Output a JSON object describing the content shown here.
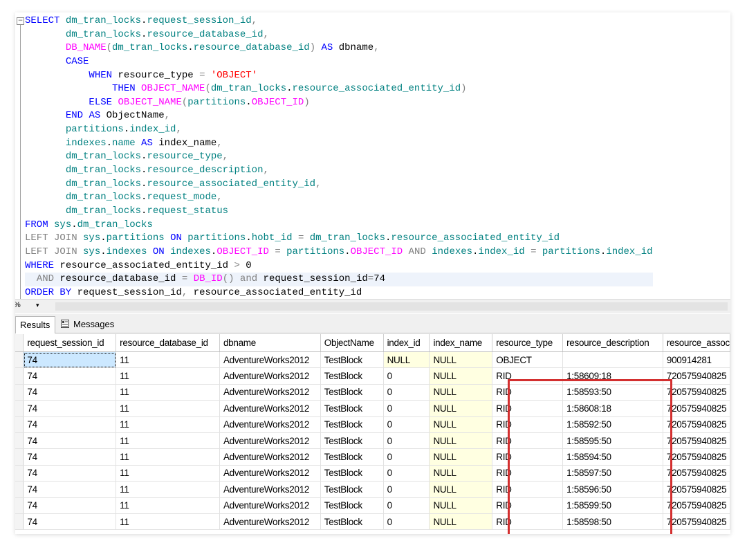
{
  "editor": {
    "lines": [
      [
        [
          "kw",
          "SELECT "
        ],
        [
          "id",
          "dm_tran_locks"
        ],
        [
          "n",
          "."
        ],
        [
          "id",
          "request_session_id"
        ],
        [
          "gy",
          ","
        ]
      ],
      [
        [
          "n",
          "       "
        ],
        [
          "id",
          "dm_tran_locks"
        ],
        [
          "n",
          "."
        ],
        [
          "id",
          "resource_database_id"
        ],
        [
          "gy",
          ","
        ]
      ],
      [
        [
          "n",
          "       "
        ],
        [
          "fn",
          "DB_NAME"
        ],
        [
          "gy",
          "("
        ],
        [
          "id",
          "dm_tran_locks"
        ],
        [
          "n",
          "."
        ],
        [
          "id",
          "resource_database_id"
        ],
        [
          "gy",
          ")"
        ],
        [
          "n",
          " "
        ],
        [
          "kw",
          "AS"
        ],
        [
          "n",
          " dbname"
        ],
        [
          "gy",
          ","
        ]
      ],
      [
        [
          "n",
          "       "
        ],
        [
          "kw",
          "CASE"
        ]
      ],
      [
        [
          "n",
          "           "
        ],
        [
          "kw",
          "WHEN"
        ],
        [
          "n",
          " resource_type "
        ],
        [
          "gy",
          "="
        ],
        [
          "n",
          " "
        ],
        [
          "st",
          "'OBJECT'"
        ]
      ],
      [
        [
          "n",
          "               "
        ],
        [
          "kw",
          "THEN"
        ],
        [
          "n",
          " "
        ],
        [
          "fn",
          "OBJECT_NAME"
        ],
        [
          "gy",
          "("
        ],
        [
          "id",
          "dm_tran_locks"
        ],
        [
          "n",
          "."
        ],
        [
          "id",
          "resource_associated_entity_id"
        ],
        [
          "gy",
          ")"
        ]
      ],
      [
        [
          "n",
          "           "
        ],
        [
          "kw",
          "ELSE"
        ],
        [
          "n",
          " "
        ],
        [
          "fn",
          "OBJECT_NAME"
        ],
        [
          "gy",
          "("
        ],
        [
          "id",
          "partitions"
        ],
        [
          "n",
          "."
        ],
        [
          "fn",
          "OBJECT_ID"
        ],
        [
          "gy",
          ")"
        ]
      ],
      [
        [
          "n",
          "       "
        ],
        [
          "kw",
          "END"
        ],
        [
          "n",
          " "
        ],
        [
          "kw",
          "AS"
        ],
        [
          "n",
          " ObjectName"
        ],
        [
          "gy",
          ","
        ]
      ],
      [
        [
          "n",
          "       "
        ],
        [
          "id",
          "partitions"
        ],
        [
          "n",
          "."
        ],
        [
          "id",
          "index_id"
        ],
        [
          "gy",
          ","
        ]
      ],
      [
        [
          "n",
          "       "
        ],
        [
          "id",
          "indexes"
        ],
        [
          "n",
          "."
        ],
        [
          "id",
          "name"
        ],
        [
          "n",
          " "
        ],
        [
          "kw",
          "AS"
        ],
        [
          "n",
          " index_name"
        ],
        [
          "gy",
          ","
        ]
      ],
      [
        [
          "n",
          "       "
        ],
        [
          "id",
          "dm_tran_locks"
        ],
        [
          "n",
          "."
        ],
        [
          "id",
          "resource_type"
        ],
        [
          "gy",
          ","
        ]
      ],
      [
        [
          "n",
          "       "
        ],
        [
          "id",
          "dm_tran_locks"
        ],
        [
          "n",
          "."
        ],
        [
          "id",
          "resource_description"
        ],
        [
          "gy",
          ","
        ]
      ],
      [
        [
          "n",
          "       "
        ],
        [
          "id",
          "dm_tran_locks"
        ],
        [
          "n",
          "."
        ],
        [
          "id",
          "resource_associated_entity_id"
        ],
        [
          "gy",
          ","
        ]
      ],
      [
        [
          "n",
          "       "
        ],
        [
          "id",
          "dm_tran_locks"
        ],
        [
          "n",
          "."
        ],
        [
          "id",
          "request_mode"
        ],
        [
          "gy",
          ","
        ]
      ],
      [
        [
          "n",
          "       "
        ],
        [
          "id",
          "dm_tran_locks"
        ],
        [
          "n",
          "."
        ],
        [
          "id",
          "request_status"
        ]
      ],
      [
        [
          "kw",
          "FROM"
        ],
        [
          "n",
          " "
        ],
        [
          "id",
          "sys"
        ],
        [
          "n",
          "."
        ],
        [
          "id",
          "dm_tran_locks"
        ]
      ],
      [
        [
          "gy",
          "LEFT JOIN"
        ],
        [
          "n",
          " "
        ],
        [
          "id",
          "sys"
        ],
        [
          "n",
          "."
        ],
        [
          "id",
          "partitions"
        ],
        [
          "n",
          " "
        ],
        [
          "kw",
          "ON"
        ],
        [
          "n",
          " "
        ],
        [
          "id",
          "partitions"
        ],
        [
          "n",
          "."
        ],
        [
          "id",
          "hobt_id"
        ],
        [
          "n",
          " "
        ],
        [
          "gy",
          "="
        ],
        [
          "n",
          " "
        ],
        [
          "id",
          "dm_tran_locks"
        ],
        [
          "n",
          "."
        ],
        [
          "id",
          "resource_associated_entity_id"
        ]
      ],
      [
        [
          "gy",
          "LEFT JOIN"
        ],
        [
          "n",
          " "
        ],
        [
          "id",
          "sys"
        ],
        [
          "n",
          "."
        ],
        [
          "id",
          "indexes"
        ],
        [
          "n",
          " "
        ],
        [
          "kw",
          "ON"
        ],
        [
          "n",
          " "
        ],
        [
          "id",
          "indexes"
        ],
        [
          "n",
          "."
        ],
        [
          "fn",
          "OBJECT_ID"
        ],
        [
          "n",
          " "
        ],
        [
          "gy",
          "="
        ],
        [
          "n",
          " "
        ],
        [
          "id",
          "partitions"
        ],
        [
          "n",
          "."
        ],
        [
          "fn",
          "OBJECT_ID"
        ],
        [
          "n",
          " "
        ],
        [
          "gy",
          "AND"
        ],
        [
          "n",
          " "
        ],
        [
          "id",
          "indexes"
        ],
        [
          "n",
          "."
        ],
        [
          "id",
          "index_id"
        ],
        [
          "n",
          " "
        ],
        [
          "gy",
          "="
        ],
        [
          "n",
          " "
        ],
        [
          "id",
          "partitions"
        ],
        [
          "n",
          "."
        ],
        [
          "id",
          "index_id"
        ]
      ],
      [
        [
          "kw",
          "WHERE"
        ],
        [
          "n",
          " resource_associated_entity_id "
        ],
        [
          "gy",
          ">"
        ],
        [
          "n",
          " 0"
        ]
      ],
      [
        [
          "n",
          "  "
        ],
        [
          "gy",
          "AND"
        ],
        [
          "n",
          " resource_database_id "
        ],
        [
          "gy",
          "="
        ],
        [
          "n",
          " "
        ],
        [
          "fn",
          "DB_ID"
        ],
        [
          "gy",
          "()"
        ],
        [
          "n",
          " "
        ],
        [
          "gy",
          "and"
        ],
        [
          "n",
          " request_session_id"
        ],
        [
          "gy",
          "="
        ],
        [
          "n",
          "74"
        ]
      ],
      [
        [
          "kw",
          "ORDER BY"
        ],
        [
          "n",
          " request_session_id"
        ],
        [
          "gy",
          ","
        ],
        [
          "n",
          " resource_associated_entity_id"
        ]
      ]
    ]
  },
  "zoom": {
    "value": "%",
    "arrow": "▾"
  },
  "tabs": {
    "results": "Results",
    "messages": "Messages"
  },
  "grid": {
    "columns": [
      "request_session_id",
      "resource_database_id",
      "dbname",
      "ObjectName",
      "index_id",
      "index_name",
      "resource_type",
      "resource_description",
      "resource_assoc"
    ],
    "rows": [
      [
        "74",
        "11",
        "AdventureWorks2012",
        "TestBlock",
        "NULL",
        "NULL",
        "OBJECT",
        "",
        "900914281"
      ],
      [
        "74",
        "11",
        "AdventureWorks2012",
        "TestBlock",
        "0",
        "NULL",
        "RID",
        "1:58609:18",
        "720575940825"
      ],
      [
        "74",
        "11",
        "AdventureWorks2012",
        "TestBlock",
        "0",
        "NULL",
        "RID",
        "1:58593:50",
        "720575940825"
      ],
      [
        "74",
        "11",
        "AdventureWorks2012",
        "TestBlock",
        "0",
        "NULL",
        "RID",
        "1:58608:18",
        "720575940825"
      ],
      [
        "74",
        "11",
        "AdventureWorks2012",
        "TestBlock",
        "0",
        "NULL",
        "RID",
        "1:58592:50",
        "720575940825"
      ],
      [
        "74",
        "11",
        "AdventureWorks2012",
        "TestBlock",
        "0",
        "NULL",
        "RID",
        "1:58595:50",
        "720575940825"
      ],
      [
        "74",
        "11",
        "AdventureWorks2012",
        "TestBlock",
        "0",
        "NULL",
        "RID",
        "1:58594:50",
        "720575940825"
      ],
      [
        "74",
        "11",
        "AdventureWorks2012",
        "TestBlock",
        "0",
        "NULL",
        "RID",
        "1:58597:50",
        "720575940825"
      ],
      [
        "74",
        "11",
        "AdventureWorks2012",
        "TestBlock",
        "0",
        "NULL",
        "RID",
        "1:58596:50",
        "720575940825"
      ],
      [
        "74",
        "11",
        "AdventureWorks2012",
        "TestBlock",
        "0",
        "NULL",
        "RID",
        "1:58599:50",
        "720575940825"
      ],
      [
        "74",
        "11",
        "AdventureWorks2012",
        "TestBlock",
        "0",
        "NULL",
        "RID",
        "1:58598:50",
        "720575940825"
      ]
    ]
  },
  "colors": {
    "keyword": "#0000ff",
    "function": "#ff00ff",
    "identifier": "#008080",
    "string": "#ff0000",
    "operator": "#808080",
    "null_cell": "#ffffe1",
    "highlight_box": "#d32f2f"
  },
  "icons": {
    "fold": "collapse-minus-icon",
    "messages": "messages-icon",
    "zoom": "chevron-down-icon"
  }
}
